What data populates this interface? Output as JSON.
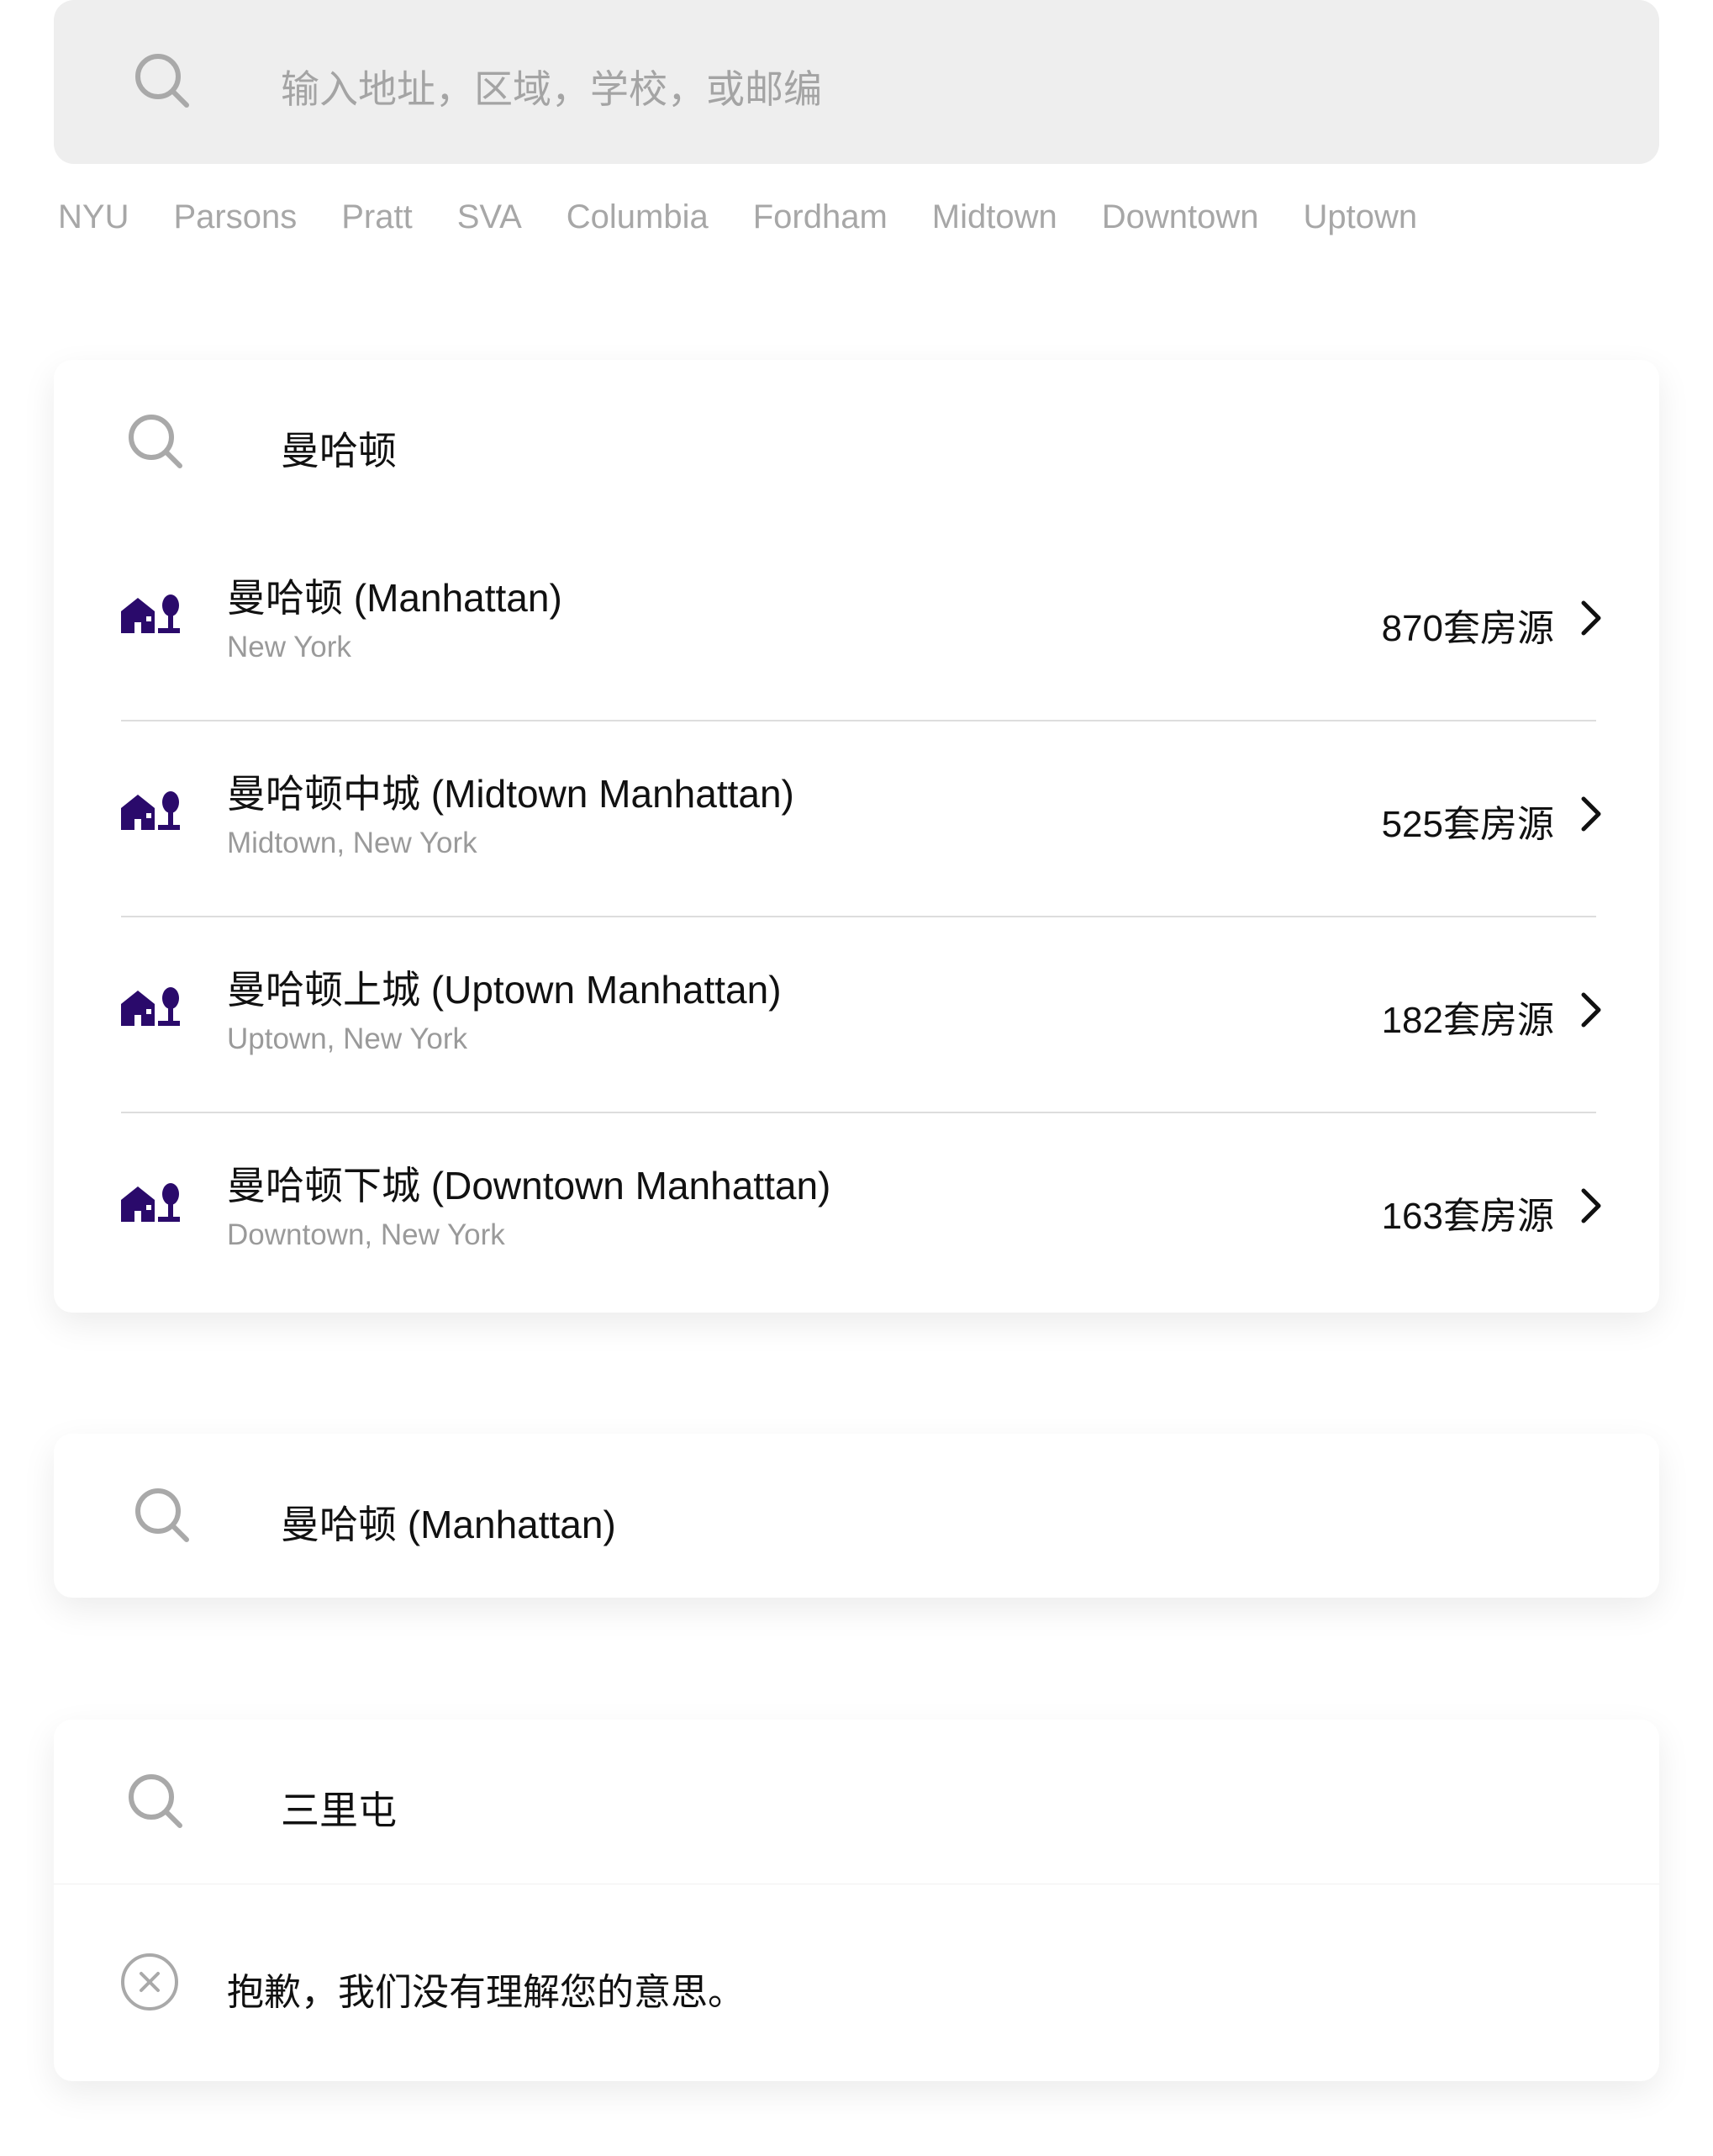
{
  "search": {
    "placeholder": "输入地址，区域，学校，或邮编"
  },
  "quick_links": [
    "NYU",
    "Parsons",
    "Pratt",
    "SVA",
    "Columbia",
    "Fordham",
    "Midtown",
    "Downtown",
    "Uptown"
  ],
  "suggest_panel": {
    "query": "曼哈顿",
    "results": [
      {
        "title": "曼哈顿 (Manhattan)",
        "subtitle": "New York",
        "count": "870套房源"
      },
      {
        "title": "曼哈顿中城 (Midtown Manhattan)",
        "subtitle": "Midtown, New York",
        "count": "525套房源"
      },
      {
        "title": "曼哈顿上城 (Uptown Manhattan)",
        "subtitle": "Uptown, New York",
        "count": "182套房源"
      },
      {
        "title": "曼哈顿下城 (Downtown Manhattan)",
        "subtitle": "Downtown, New York",
        "count": "163套房源"
      }
    ]
  },
  "selected_panel": {
    "query": "曼哈顿 (Manhattan)"
  },
  "error_panel": {
    "query": "三里屯",
    "message": "抱歉，我们没有理解您的意思。"
  },
  "colors": {
    "accent": "#2a0a6b",
    "search_bg": "#eeeeee",
    "placeholder": "#a4a4a4",
    "quick_link": "#a7a7a7",
    "subtitle": "#9a9a9a",
    "divider": "#dddddd"
  },
  "icons": {
    "search": "search-icon",
    "location": "building-tree-icon",
    "chevron": "chevron-right-icon",
    "error": "close-circle-icon"
  }
}
